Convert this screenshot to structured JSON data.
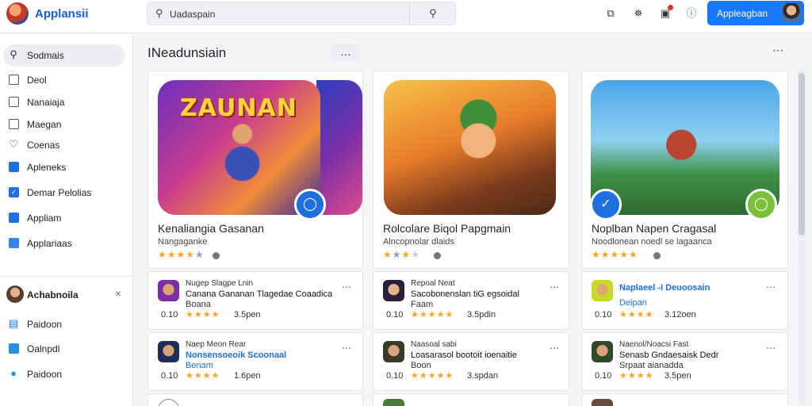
{
  "app": {
    "name": "Applansii"
  },
  "search": {
    "value": "Uadaspain"
  },
  "header": {
    "cta_label": "Appleagban"
  },
  "sidebar": {
    "items": [
      {
        "label": "Sodmais"
      },
      {
        "label": "Deol"
      },
      {
        "label": "Nanaiaja"
      },
      {
        "label": "Maegan"
      },
      {
        "label": "Coenas"
      },
      {
        "label": "Apleneks"
      },
      {
        "label": "Demar Pelolias"
      },
      {
        "label": "Appliam"
      },
      {
        "label": "Applariaas"
      }
    ],
    "account": {
      "label": "Achabnoila"
    },
    "sub_items": [
      {
        "label": "Paidoon"
      },
      {
        "label": "Oalnpdl"
      },
      {
        "label": "Paidoon"
      }
    ]
  },
  "main": {
    "section_title": "INeadunsiain",
    "featured": [
      {
        "art_text": "ZAUNAN",
        "title": "Kenaliangia Gasanan",
        "subtitle": "Nangaganke",
        "rating": 4.5
      },
      {
        "title": "Rolcolare Biqol Papgmain",
        "subtitle": "Alncopnolar dlaids",
        "rating": 2.5
      },
      {
        "title": "Noplban Napen Cragasal",
        "subtitle": "Noodlonean noedl se lagaanca",
        "rating": 5
      }
    ],
    "list": [
      {
        "publisher": "Nugep Slagpe Lnin",
        "name": "Canana Gananan Tlagedae Coaadica",
        "meta": "Boana",
        "price": "0.10",
        "rating": 4,
        "count": "3.5pen"
      },
      {
        "publisher": "Repoal Neat",
        "name": "Sacobonenslan tiG egsoidal",
        "meta": "Faam",
        "price": "0.10",
        "rating": 5,
        "count": "3.5pdin"
      },
      {
        "publisher": "Naplaeel -I Deuoosain",
        "name": "Deipan",
        "meta": "",
        "price": "0.10",
        "rating": 4,
        "count": "3.12oen"
      },
      {
        "publisher": "Naep Meon Rear",
        "name": "Nonsensoeoik Scoonaal",
        "meta": "Benam",
        "price": "0.10",
        "rating": 4,
        "count": "1.6pen"
      },
      {
        "publisher": "Naasoal sabi",
        "name": "Loasarasol bootoit ioenaitie",
        "meta": "Boon",
        "price": "0.10",
        "rating": 5,
        "count": "3.spdan"
      },
      {
        "publisher": "Naenol/Noacsi Fast",
        "name": "Senasb Gndaesaisk Dedr",
        "meta": "Srpaat aianadda",
        "price": "0.10",
        "rating": 4,
        "count": "3.5pen"
      }
    ]
  }
}
